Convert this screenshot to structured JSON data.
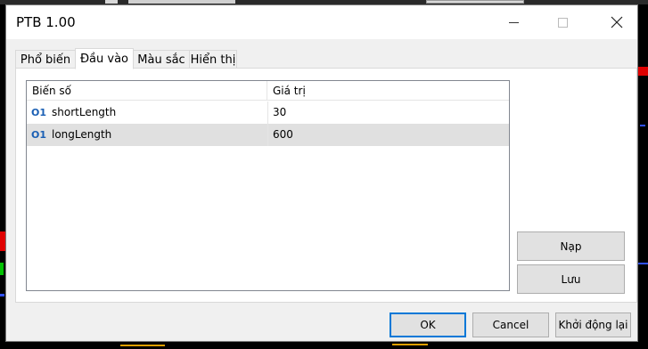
{
  "window": {
    "title": "PTB 1.00"
  },
  "tabs": [
    {
      "label": "Phổ biến",
      "active": false
    },
    {
      "label": "Đầu vào",
      "active": true
    },
    {
      "label": "Màu sắc",
      "active": false
    },
    {
      "label": "Hiển thị",
      "active": false
    }
  ],
  "inputs_table": {
    "headers": {
      "name": "Biến số",
      "value": "Giá trị"
    },
    "rows": [
      {
        "icon": "O1",
        "name": "shortLength",
        "value": "30"
      },
      {
        "icon": "O1",
        "name": "longLength",
        "value": "600"
      }
    ]
  },
  "side_buttons": {
    "load": "Nạp",
    "save": "Lưu"
  },
  "footer_buttons": {
    "ok": "OK",
    "cancel": "Cancel",
    "reset": "Khởi động lại"
  },
  "colors": {
    "accent": "#0078d7",
    "selected_row": "#e0e0e0",
    "input_icon": "#1a5fb4"
  }
}
